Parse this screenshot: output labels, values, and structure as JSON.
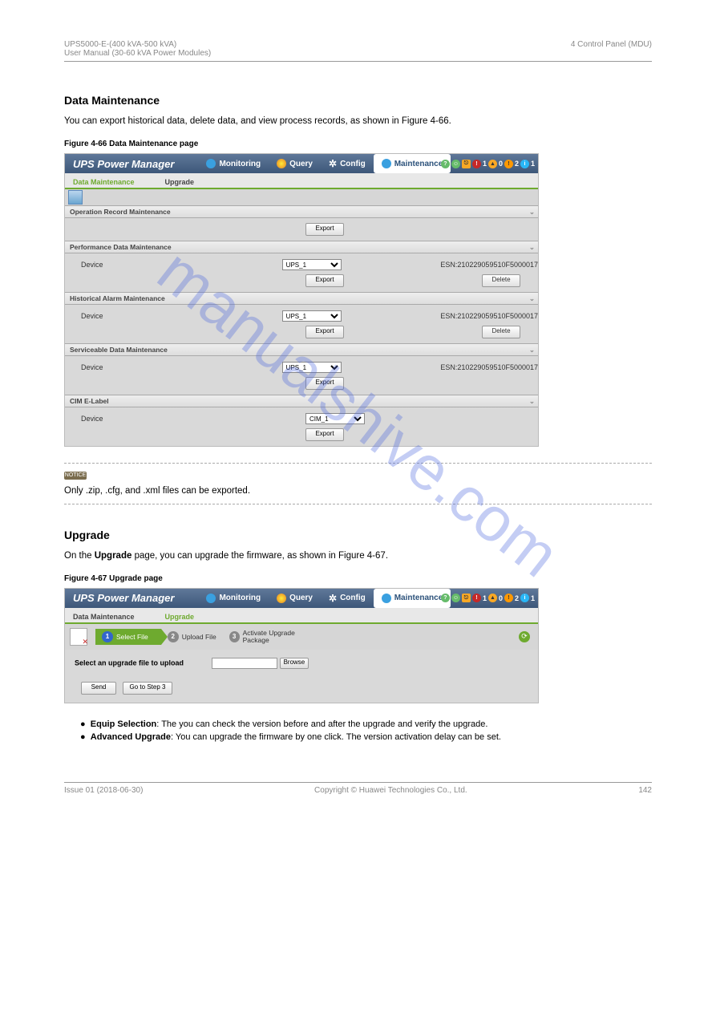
{
  "doc": {
    "productLine": "UPS5000-E-(400 kVA-500 kVA)",
    "manualTitle": "User Manual (30-60 kVA Power Modules)",
    "chapter": "4 Control Panel (MDU)"
  },
  "sec1": {
    "heading": "Data Maintenance",
    "intro": "You can export historical data, delete data, and view process records, as shown in ",
    "figRef": "Figure 4-66",
    "caption": "Figure 4-66 Data Maintenance page"
  },
  "shot1": {
    "brand": "UPS Power Manager",
    "nav": [
      "Monitoring",
      "Query",
      "Config",
      "Maintenance"
    ],
    "statusCounts": [
      "1",
      "0",
      "2",
      "1"
    ],
    "subtabs": [
      "Data Maintenance",
      "Upgrade"
    ],
    "activeSubtab": 0,
    "panels": {
      "op": {
        "title": "Operation Record Maintenance",
        "export": "Export"
      },
      "perf": {
        "title": "Performance Data Maintenance",
        "device": "Device",
        "sel": "UPS_1",
        "esn": "ESN:210229059510F5000017",
        "export": "Export",
        "delete": "Delete"
      },
      "hist": {
        "title": "Historical Alarm Maintenance",
        "device": "Device",
        "sel": "UPS_1",
        "esn": "ESN:210229059510F5000017",
        "export": "Export",
        "delete": "Delete"
      },
      "serv": {
        "title": "Serviceable Data Maintenance",
        "device": "Device",
        "sel": "UPS_1",
        "esn": "ESN:210229059510F5000017",
        "export": "Export"
      },
      "cim": {
        "title": "CIM E-Label",
        "device": "Device",
        "sel": "CIM_1",
        "export": "Export"
      }
    }
  },
  "notice": {
    "text": "Only .zip, .cfg, and .xml files can be exported."
  },
  "sec2": {
    "heading": "Upgrade",
    "intro": "On the ",
    "intro2": "Upgrade",
    "intro3": " page, you can upgrade the firmware, as shown in ",
    "figRef": "Figure 4-67",
    "caption": "Figure 4-67 Upgrade page"
  },
  "shot2": {
    "brand": "UPS Power Manager",
    "nav": [
      "Monitoring",
      "Query",
      "Config",
      "Maintenance"
    ],
    "statusCounts": [
      "1",
      "0",
      "2",
      "1"
    ],
    "subtabs": [
      "Data Maintenance",
      "Upgrade"
    ],
    "activeSubtab": 1,
    "steps": [
      "Select File",
      "Upload File",
      "Activate Upgrade Package"
    ],
    "uploadLabel": "Select an upgrade file to upload",
    "browse": "Browse",
    "send": "Send",
    "goto": "Go to Step 3"
  },
  "postBullets": {
    "b1label": "Equip Selection",
    "b1text": "The you can check the version before and after the upgrade and verify the upgrade.",
    "b2label": "Advanced Upgrade",
    "b2text": ": You can upgrade the firmware by one click. The version activation delay can be set."
  },
  "footer": {
    "issue": "Issue 01 (2018-06-30)",
    "copyright": "Copyright © Huawei Technologies Co., Ltd.",
    "page": "142"
  },
  "watermark": "manualshive.com"
}
